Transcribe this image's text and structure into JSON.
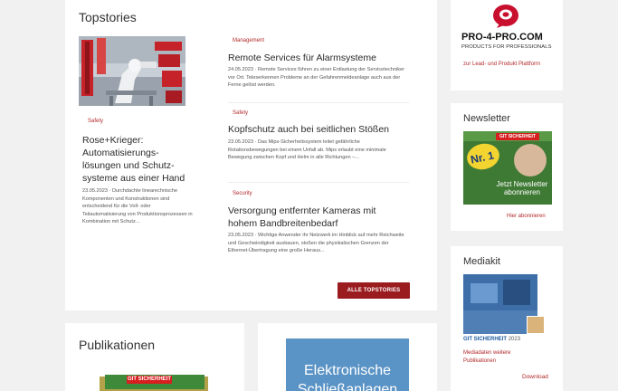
{
  "topstories": {
    "heading": "Topstories",
    "featured": {
      "category": "Safety",
      "title": "Rose+Krieger: Automatisierungs-lösungen und Schutz-systeme aus einer Hand",
      "date_prefix": "23.05.2023",
      "excerpt": "Durchdachte linearechnische Komponenten und Konstruktionen sind entscheidend für die Voll- oder Teilautomatisierung von Produktionsprozessen in Kombination mit Schutz..."
    },
    "articles": [
      {
        "category": "Management",
        "title": "Remote Services für Alarmsysteme",
        "date": "24.05.2023",
        "excerpt": "Remote Services führen zu einer Entlastung der Servicetechniker vor Ort. Teleserkennen Probleme an der Gefahrenmeldeanlage auch aus der Ferne gelöst werden."
      },
      {
        "category": "Safety",
        "title": "Kopfschutz auch bei seitlichen Stößen",
        "date": "23.05.2023",
        "excerpt": "Das Mips-Sicherheitssystem leitet gefährliche Rotationsbewegungen bei einem Unfall ab. Mips erlaubt eine minimale Bewegung zwischen Kopf und Helm in alle Richtungen –..."
      },
      {
        "category": "Security",
        "title": "Versorgung entfernter Kameras mit hohem Bandbreitenbedarf",
        "date": "23.05.2023",
        "excerpt": "Wichtige Anwender ihr Netzwerk im Hinblick auf mehr Reichweite und Geschwindigkeit ausbauen, stoßen die physikalischen Grenzen der Ethernet-Übertragung eine große Heraus..."
      }
    ],
    "all_button": "ALLE TOPSTORIES"
  },
  "sidebar": {
    "pro4pro": {
      "logo_text": "PRO-4-PRO.COM",
      "tagline": "PRODUCTS FOR PROFESSIONALS",
      "description": "zur Lead- und Produkt Plattform"
    },
    "newsletter": {
      "heading": "Newsletter",
      "cover_brand": "GIT SICHERHEIT",
      "cover_badge": "Nr. 1",
      "cover_cta": "Jetzt Newsletter abonnieren",
      "link": "Hier abonnieren"
    },
    "mediakit": {
      "heading": "Mediakit",
      "brand": "GIT SICHERHEIT",
      "year": "2023",
      "description": "Mediadaten weitere Publikationen",
      "link": "Download"
    }
  },
  "publications": {
    "heading": "Publikationen",
    "magazine_brand": "GIT SICHERHEIT",
    "banner_line1": "Elektronische",
    "banner_line2": "Schließanlagen"
  },
  "colors": {
    "accent": "#9a1c1f",
    "link": "#b22828",
    "background": "#f1f1f1"
  }
}
